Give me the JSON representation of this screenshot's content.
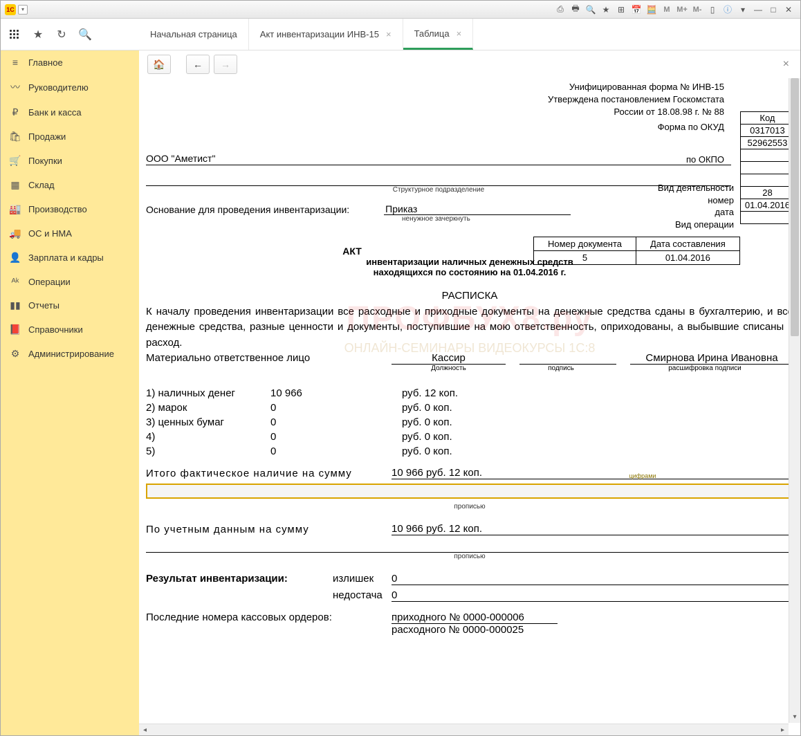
{
  "titlebar": {
    "toolicons": [
      "⎙",
      "🖶",
      "🔍",
      "★",
      "⊞",
      "📅",
      "🧮",
      "M",
      "M+",
      "M-",
      "▯",
      "ⓘ"
    ]
  },
  "tabs": [
    {
      "label": "Начальная страница",
      "closable": false
    },
    {
      "label": "Акт инвентаризации ИНВ-15",
      "closable": true
    },
    {
      "label": "Таблица",
      "closable": true,
      "active": true
    }
  ],
  "sidebar": [
    {
      "icon": "≡",
      "label": "Главное"
    },
    {
      "icon": "〰",
      "label": "Руководителю"
    },
    {
      "icon": "₽",
      "label": "Банк и касса"
    },
    {
      "icon": "🛍",
      "label": "Продажи"
    },
    {
      "icon": "🛒",
      "label": "Покупки"
    },
    {
      "icon": "▦",
      "label": "Склад"
    },
    {
      "icon": "🏭",
      "label": "Производство"
    },
    {
      "icon": "🚚",
      "label": "ОС и НМА"
    },
    {
      "icon": "👤",
      "label": "Зарплата и кадры"
    },
    {
      "icon": "ᴬᵏ",
      "label": "Операции"
    },
    {
      "icon": "▮▮",
      "label": "Отчеты"
    },
    {
      "icon": "📕",
      "label": "Справочники"
    },
    {
      "icon": "⚙",
      "label": "Администрирование"
    }
  ],
  "doc": {
    "form_header_1": "Унифицированная форма № ИНВ-15",
    "form_header_2": "Утверждена постановлением Госкомстата",
    "form_header_3": "России от 18.08.98 г. № 88",
    "code_label": "Код",
    "okud_label": "Форма по ОКУД",
    "okud": "0317013",
    "okpo_label": "по ОКПО",
    "okpo": "52962553",
    "org": "ООО \"Аметист\"",
    "struct_label": "Структурное подразделение",
    "basis_label": "Основание для проведения инвентаризации:",
    "basis_value": "Приказ",
    "strike_note": "ненужное зачеркнуть",
    "activity_label": "Вид деятельности",
    "number_label": "номер",
    "number_value": "28",
    "date_label": "дата",
    "date_value": "01.04.2016",
    "optype_label": "Вид операции",
    "doc_num_header": "Номер документа",
    "doc_date_header": "Дата составления",
    "doc_num": "5",
    "doc_date": "01.04.2016",
    "act_title": "АКТ",
    "act_sub1": "инвентаризации наличных денежных средств",
    "act_sub2": "находящихся по состоянию на 01.04.2016 г.",
    "raspiska": "РАСПИСКА",
    "body": "К началу проведения инвентаризации все расходные и приходные документы на денежные средства сданы в бухгалтерию, и все денежные средства, разные ценности и документы, поступившие на мою ответственность, оприходованы, а выбывшие списаны в расход.",
    "mol_label": "Материально ответственное лицо",
    "mol_position": "Кассир",
    "mol_name": "Смирнова Ирина Ивановна",
    "sub_position": "Должность",
    "sub_sign": "подпись",
    "sub_name": "расшифровка подписи",
    "rows": [
      {
        "n": "1) наличных денег",
        "v": "10 966",
        "u": "руб. 12 коп."
      },
      {
        "n": "2) марок",
        "v": "0",
        "u": "руб. 0 коп."
      },
      {
        "n": "3) ценных бумаг",
        "v": "0",
        "u": "руб. 0 коп."
      },
      {
        "n": "4)",
        "v": "0",
        "u": "руб. 0 коп."
      },
      {
        "n": "5)",
        "v": "0",
        "u": "руб. 0 коп."
      }
    ],
    "total_fact_label": "Итого фактическое наличие на сумму",
    "total_fact_value": "10 966 руб. 12 коп.",
    "tiny_label": "цифрами",
    "propis": "прописью",
    "book_label": "По учетным данным на сумму",
    "book_value": "10 966 руб. 12 коп.",
    "result_label": "Результат инвентаризации:",
    "surplus_label": "излишек",
    "surplus_value": "0",
    "shortage_label": "недостача",
    "shortage_value": "0",
    "orders_label": "Последние номера кассовых ордеров:",
    "income_order": "приходного № 0000-000006",
    "expense_order": "расходного № 0000-000025"
  }
}
